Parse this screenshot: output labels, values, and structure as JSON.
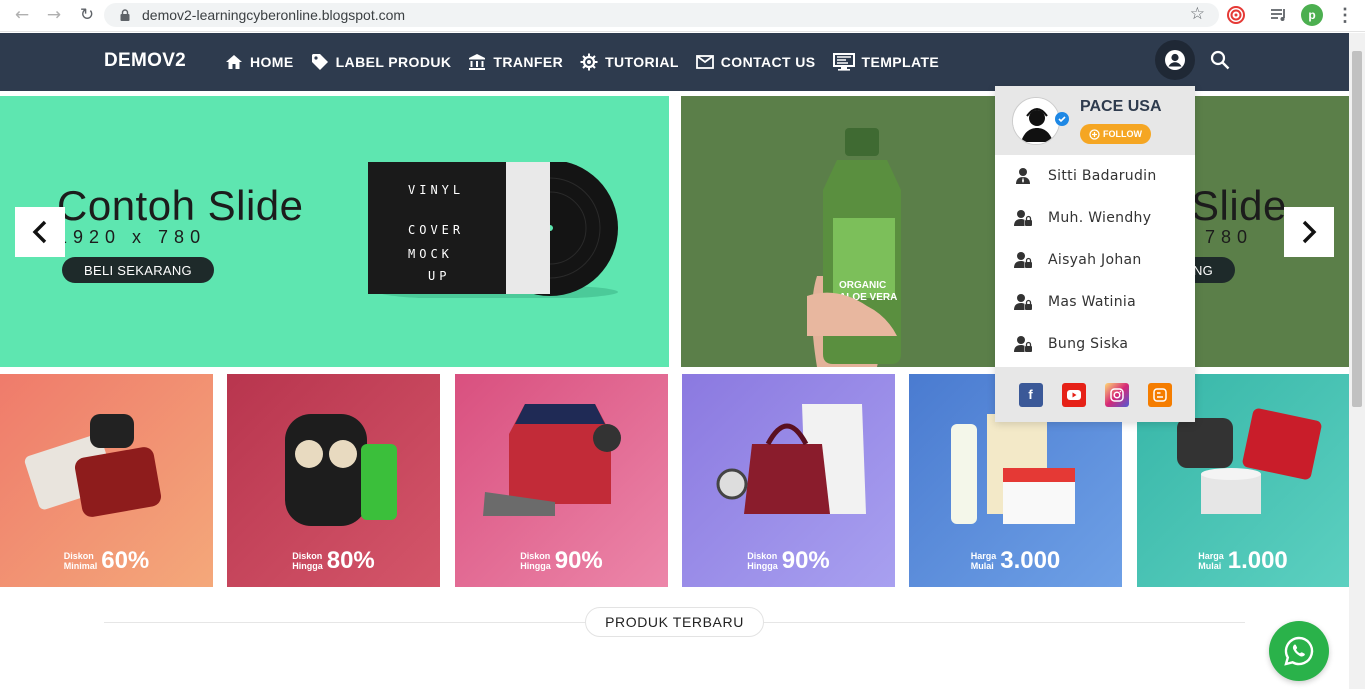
{
  "browser": {
    "url": "demov2-learningcyberonline.blogspot.com",
    "profile_initial": "p"
  },
  "site": {
    "logo": "DEMOV2",
    "menu": [
      {
        "label": "HOME",
        "icon": "home-icon"
      },
      {
        "label": "LABEL PRODUK",
        "icon": "tag-icon"
      },
      {
        "label": "TRANFER",
        "icon": "bank-icon"
      },
      {
        "label": "TUTORIAL",
        "icon": "gear-icon"
      },
      {
        "label": "CONTACT US",
        "icon": "mail-icon"
      },
      {
        "label": "TEMPLATE",
        "icon": "monitor-icon"
      }
    ]
  },
  "slides": [
    {
      "title": "Contoh Slide",
      "subtitle": "1920 x 780",
      "button": "BELI SEKARANG",
      "bg": "#5ee6b0"
    },
    {
      "title": "Slide",
      "subtitle": "780",
      "button": "NG",
      "bg": "#5b7f49"
    }
  ],
  "tiles": [
    {
      "small1": "Diskon",
      "small2": "Minimal",
      "big": "60%",
      "bg": "#f08a6a"
    },
    {
      "small1": "Diskon",
      "small2": "Hingga",
      "big": "80%",
      "bg": "#c83f5a"
    },
    {
      "small1": "Diskon",
      "small2": "Hingga",
      "big": "90%",
      "bg": "#e0608f"
    },
    {
      "small1": "Diskon",
      "small2": "Hingga",
      "big": "90%",
      "bg": "#9486e6"
    },
    {
      "small1": "Harga",
      "small2": "Mulai",
      "big": "3.000",
      "bg": "#4f83d3"
    },
    {
      "small1": "Harga",
      "small2": "Mulai",
      "big": "1.000",
      "bg": "#3cbfb0"
    }
  ],
  "section": {
    "title": "PRODUK TERBARU"
  },
  "dropdown": {
    "name": "PACE USA",
    "follow": "FOLLOW",
    "users": [
      "Sitti Badarudin",
      "Muh. Wiendhy",
      "Aisyah Johan",
      "Mas Watinia",
      "Bung Siska"
    ],
    "social": [
      {
        "name": "facebook-icon",
        "color": "#3b5998"
      },
      {
        "name": "youtube-icon",
        "color": "#e62117"
      },
      {
        "name": "instagram-icon",
        "color": "#c13584"
      },
      {
        "name": "blogger-icon",
        "color": "#f57d00"
      }
    ]
  }
}
